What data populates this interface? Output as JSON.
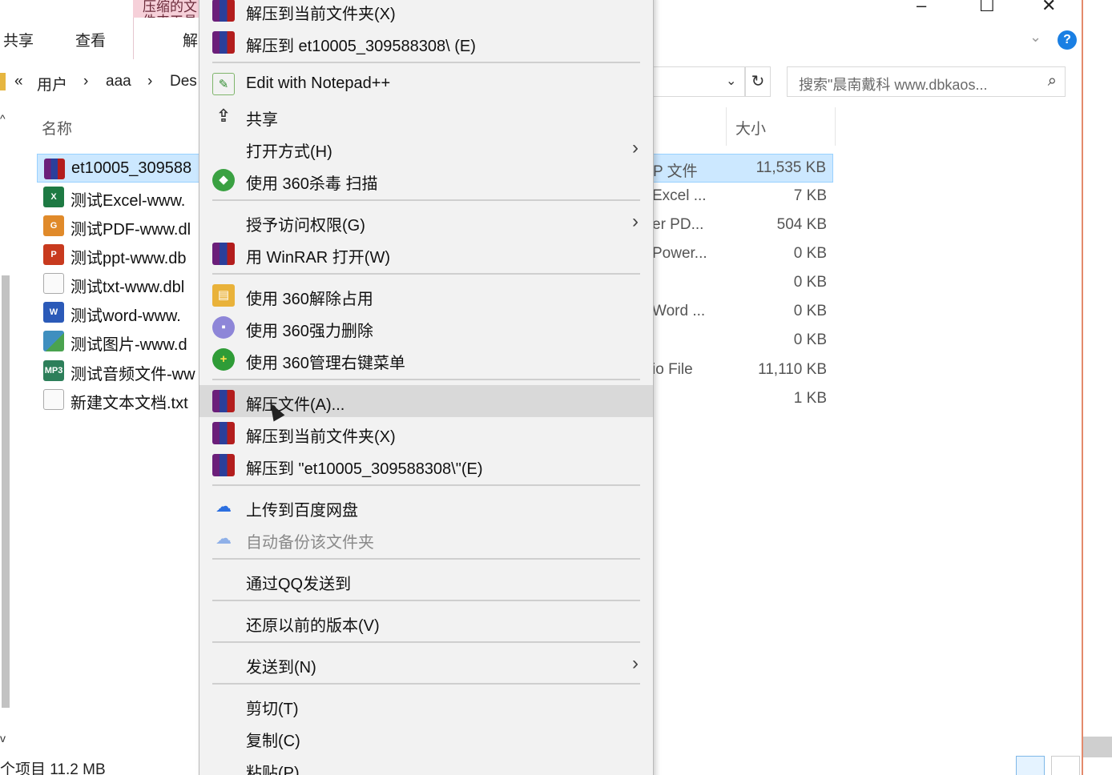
{
  "ribbon": {
    "context_tab": "压缩的文件夹工具",
    "tabs": [
      "共享",
      "查看",
      "解"
    ],
    "window_buttons": [
      "–",
      "☐",
      "✕"
    ],
    "help": "?"
  },
  "address": {
    "crumbs": [
      "«",
      "用户",
      "›",
      "aaa",
      "›",
      "Des"
    ]
  },
  "search": {
    "placeholder": "搜索\"晨南戴科 www.dbkaos..."
  },
  "columns": {
    "name": "名称",
    "size": "大小"
  },
  "files": [
    {
      "name": "et10005_309588",
      "type": "P 文件",
      "size": "11,535 KB",
      "icon": "rar-icon",
      "icon_text": "",
      "color": "#b31d1d"
    },
    {
      "name": "测试Excel-www.",
      "type": "Excel ...",
      "size": "7 KB",
      "icon": "excel-icon",
      "icon_text": "X",
      "color": "#1e7a43"
    },
    {
      "name": "测试PDF-www.dl",
      "type": "er PD...",
      "size": "504 KB",
      "icon": "pdf-icon",
      "icon_text": "G",
      "color": "#e08a2a"
    },
    {
      "name": "测试ppt-www.db",
      "type": "Power...",
      "size": "0 KB",
      "icon": "ppt-icon",
      "icon_text": "P",
      "color": "#c83a1e"
    },
    {
      "name": "测试txt-www.dbl",
      "type": "",
      "size": "0 KB",
      "icon": "txt-icon",
      "icon_text": "",
      "color": "#bfbfbf"
    },
    {
      "name": "测试word-www.",
      "type": "Word ...",
      "size": "0 KB",
      "icon": "word-icon",
      "icon_text": "W",
      "color": "#2b5ab8"
    },
    {
      "name": "测试图片-www.d",
      "type": "",
      "size": "0 KB",
      "icon": "image-icon",
      "icon_text": "",
      "color": "#3f8fbf"
    },
    {
      "name": "测试音频文件-ww",
      "type": "io File",
      "size": "11,110 KB",
      "icon": "audio-icon",
      "icon_text": "MP3",
      "color": "#2d7f5a"
    },
    {
      "name": "新建文本文档.txt",
      "type": "",
      "size": "1 KB",
      "icon": "txt-icon",
      "icon_text": "",
      "color": "#bfbfbf"
    }
  ],
  "status": {
    "text": "个项目  11.2 MB"
  },
  "context_menu": {
    "items": [
      {
        "label": "解压到当前文件夹(X)",
        "icon": "winrar-icon"
      },
      {
        "label": "解压到 et10005_309588308\\ (E)",
        "icon": "winrar-icon"
      },
      {
        "label": "Edit with Notepad++",
        "icon": "notepad-plus-plus-icon"
      },
      {
        "label": "共享",
        "icon": "share-icon"
      },
      {
        "label": "打开方式(H)",
        "icon": "",
        "submenu": true
      },
      {
        "label": "使用 360杀毒 扫描",
        "icon": "360-antivirus-icon"
      },
      {
        "label": "授予访问权限(G)",
        "icon": "",
        "submenu": true
      },
      {
        "label": "用 WinRAR 打开(W)",
        "icon": "winrar-icon"
      },
      {
        "label": "使用 360解除占用",
        "icon": "360-unlock-icon"
      },
      {
        "label": "使用 360强力删除",
        "icon": "360-force-delete-icon"
      },
      {
        "label": "使用 360管理右键菜单",
        "icon": "360-menu-manager-icon"
      },
      {
        "label": "解压文件(A)...",
        "icon": "winrar-icon",
        "hover": true
      },
      {
        "label": "解压到当前文件夹(X)",
        "icon": "winrar-icon"
      },
      {
        "label": "解压到 \"et10005_309588308\\\"(E)",
        "icon": "winrar-icon"
      },
      {
        "label": "上传到百度网盘",
        "icon": "baidu-netdisk-icon"
      },
      {
        "label": "自动备份该文件夹",
        "icon": "baidu-netdisk-icon",
        "disabled": true
      },
      {
        "label": "通过QQ发送到",
        "icon": ""
      },
      {
        "label": "还原以前的版本(V)",
        "icon": ""
      },
      {
        "label": "发送到(N)",
        "icon": "",
        "submenu": true
      },
      {
        "label": "剪切(T)",
        "icon": ""
      },
      {
        "label": "复制(C)",
        "icon": ""
      },
      {
        "label": "粘贴(P)",
        "icon": ""
      }
    ]
  },
  "colors": {
    "selection": "#cce8ff",
    "menu_bg": "#f2f2f2",
    "hover": "#d9d9d9",
    "accent": "#1a7fe3"
  }
}
